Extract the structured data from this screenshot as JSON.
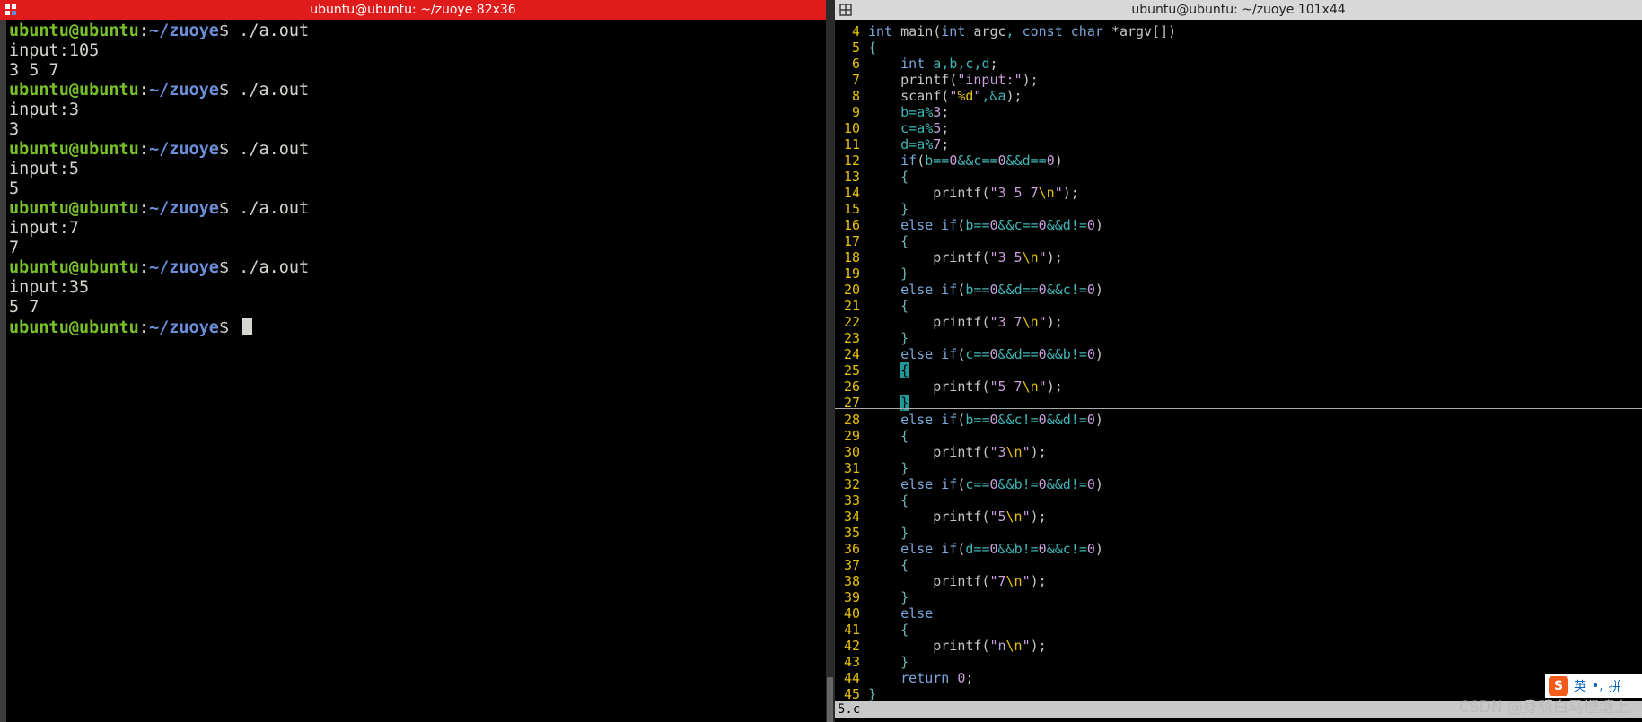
{
  "left_terminal": {
    "title": "ubuntu@ubuntu: ~/zuoye 82x36",
    "user": "ubuntu@ubuntu",
    "path": "~/zuoye",
    "lines": [
      {
        "type": "prompt",
        "cmd": " ./a.out"
      },
      {
        "type": "out",
        "text": "input:105"
      },
      {
        "type": "out",
        "text": "3 5 7"
      },
      {
        "type": "prompt",
        "cmd": " ./a.out"
      },
      {
        "type": "out",
        "text": "input:3"
      },
      {
        "type": "out",
        "text": "3"
      },
      {
        "type": "prompt",
        "cmd": " ./a.out"
      },
      {
        "type": "out",
        "text": "input:5"
      },
      {
        "type": "out",
        "text": "5"
      },
      {
        "type": "prompt",
        "cmd": " ./a.out"
      },
      {
        "type": "out",
        "text": "input:7"
      },
      {
        "type": "out",
        "text": "7"
      },
      {
        "type": "prompt",
        "cmd": " ./a.out"
      },
      {
        "type": "out",
        "text": "input:35"
      },
      {
        "type": "out",
        "text": "5 7"
      },
      {
        "type": "prompt",
        "cmd": " ",
        "cursor": true
      }
    ]
  },
  "right_terminal": {
    "title": "ubuntu@ubuntu: ~/zuoye 101x44",
    "status_file": "5.c",
    "top_lines": [
      {
        "n": "4",
        "code": "int main(int argc, const char *argv[])"
      },
      {
        "n": "5",
        "code": "{"
      },
      {
        "n": "6",
        "code": "    int a,b,c,d;"
      },
      {
        "n": "7",
        "code": "    printf(\"input:\");"
      },
      {
        "n": "8",
        "code": "    scanf(\"%d\",&a);"
      },
      {
        "n": "9",
        "code": "    b=a%3;"
      },
      {
        "n": "10",
        "code": "    c=a%5;"
      },
      {
        "n": "11",
        "code": "    d=a%7;"
      },
      {
        "n": "12",
        "code": "    if(b==0&&c==0&&d==0)"
      },
      {
        "n": "13",
        "code": "    {"
      },
      {
        "n": "14",
        "code": "        printf(\"3 5 7\\n\");"
      },
      {
        "n": "15",
        "code": "    }"
      },
      {
        "n": "16",
        "code": "    else if(b==0&&c==0&&d!=0)"
      },
      {
        "n": "17",
        "code": "    {"
      },
      {
        "n": "18",
        "code": "        printf(\"3 5\\n\");"
      },
      {
        "n": "19",
        "code": "    }"
      },
      {
        "n": "20",
        "code": "    else if(b==0&&d==0&&c!=0)"
      },
      {
        "n": "21",
        "code": "    {"
      },
      {
        "n": "22",
        "code": "        printf(\"3 7\\n\");"
      },
      {
        "n": "23",
        "code": "    }"
      },
      {
        "n": "24",
        "code": "    else if(c==0&&d==0&&b!=0)"
      },
      {
        "n": "25",
        "code": "    {"
      },
      {
        "n": "26",
        "code": "        printf(\"5 7\\n\");"
      },
      {
        "n": "27",
        "code": "    }"
      }
    ],
    "bottom_lines": [
      {
        "n": "28",
        "code": "    else if(b==0&&c!=0&&d!=0)"
      },
      {
        "n": "29",
        "code": "    {"
      },
      {
        "n": "30",
        "code": "        printf(\"3\\n\");"
      },
      {
        "n": "31",
        "code": "    }"
      },
      {
        "n": "32",
        "code": "    else if(c==0&&b!=0&&d!=0)"
      },
      {
        "n": "33",
        "code": "    {"
      },
      {
        "n": "34",
        "code": "        printf(\"5\\n\");"
      },
      {
        "n": "35",
        "code": "    }"
      },
      {
        "n": "36",
        "code": "    else if(d==0&&b!=0&&c!=0)"
      },
      {
        "n": "37",
        "code": "    {"
      },
      {
        "n": "38",
        "code": "        printf(\"7\\n\");"
      },
      {
        "n": "39",
        "code": "    }"
      },
      {
        "n": "40",
        "code": "    else"
      },
      {
        "n": "41",
        "code": "    {"
      },
      {
        "n": "42",
        "code": "        printf(\"n\\n\");"
      },
      {
        "n": "43",
        "code": "    }"
      },
      {
        "n": "44",
        "code": "    return 0;"
      },
      {
        "n": "45",
        "code": "}"
      }
    ]
  },
  "watermark": "CSDN @身骑白马埋塘上",
  "ime": {
    "logo": "S",
    "lang": "英",
    "punct": "•,",
    "mode": "拼"
  },
  "colors": {
    "active_title": "#e01b1b",
    "inactive_title": "#d8d8d8",
    "user": "#78c028",
    "path": "#6b8ed8",
    "line_number": "#e5c107"
  }
}
